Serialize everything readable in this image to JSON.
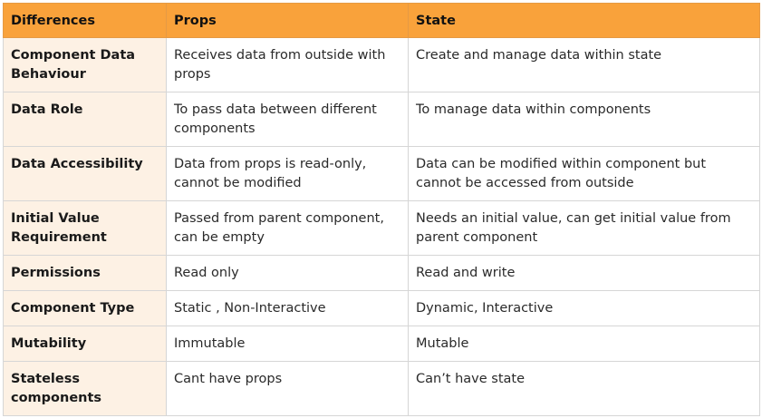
{
  "table": {
    "headers": [
      "Differences",
      "Props",
      "State"
    ],
    "rows": [
      {
        "label": "Component Data Behaviour",
        "props": "Receives data from outside with props",
        "state": "Create and manage data within state"
      },
      {
        "label": "Data Role",
        "props": "To pass data between different components",
        "state": "To manage data within components"
      },
      {
        "label": "Data Accessibility",
        "props": "Data from props is read-only, cannot be modified",
        "state": "Data can be modified within component but cannot be accessed from outside"
      },
      {
        "label": "Initial Value Requirement",
        "props": "Passed from parent component, can be empty",
        "state": "Needs an initial value, can get initial value from parent component"
      },
      {
        "label": "Permissions",
        "props": "Read only",
        "state": "Read and write"
      },
      {
        "label": "Component Type",
        "props": "Static , Non-Interactive",
        "state": "Dynamic, Interactive"
      },
      {
        "label": "Mutability",
        "props": "Immutable",
        "state": "Mutable"
      },
      {
        "label": "Stateless components",
        "props": "Cant have props",
        "state": "Can’t have state"
      }
    ]
  },
  "colors": {
    "header_bg": "#f9a23b",
    "rowhead_bg": "#fdf1e4",
    "border": "#d6d6d6"
  }
}
